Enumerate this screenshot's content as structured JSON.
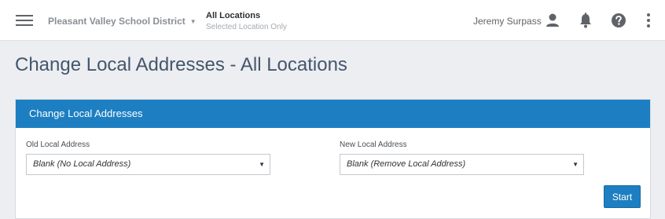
{
  "header": {
    "district": "Pleasant Valley School District",
    "location_title": "All Locations",
    "location_subtitle": "Selected Location Only",
    "username": "Jeremy Surpass"
  },
  "icons": {
    "menu": "hamburger-icon",
    "district_caret": "caret-down-icon",
    "user": "user-icon",
    "notifications": "bell-icon",
    "help": "help-icon",
    "more": "more-vertical-icon"
  },
  "page": {
    "title": "Change Local Addresses - All Locations"
  },
  "card": {
    "header": "Change Local Addresses",
    "old_label": "Old Local Address",
    "old_value": "Blank (No Local Address)",
    "new_label": "New Local Address",
    "new_value": "Blank (Remove Local Address)",
    "start_label": "Start"
  },
  "colors": {
    "accent": "#1d7fc1",
    "page_background": "#eceef2",
    "title_text": "#44566b"
  }
}
